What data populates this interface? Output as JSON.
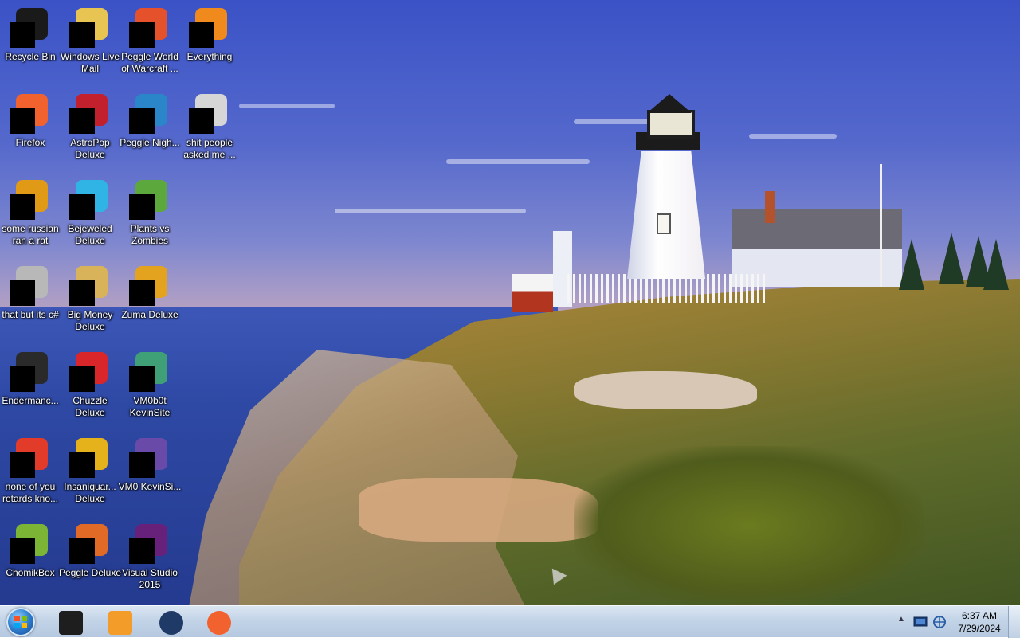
{
  "desktop": {
    "icons": [
      {
        "label": "Recycle Bin",
        "icon": "recycle-bin-icon",
        "color": "#1a1a1a"
      },
      {
        "label": "Windows Live Mail",
        "icon": "mail-icon",
        "color": "#e8c552"
      },
      {
        "label": "Peggle World of Warcraft ...",
        "icon": "peggle-icon",
        "color": "#e4512b"
      },
      {
        "label": "Everything",
        "icon": "everything-icon",
        "color": "#f08a1c"
      },
      {
        "label": "Firefox",
        "icon": "firefox-icon",
        "color": "#f2622e"
      },
      {
        "label": "AstroPop Deluxe",
        "icon": "astropop-icon",
        "color": "#c2202c"
      },
      {
        "label": "Peggle Nigh...",
        "icon": "peggle-nights-icon",
        "color": "#2a86c8"
      },
      {
        "label": "shit people asked me ...",
        "icon": "folder-icon",
        "color": "#d6d6d6"
      },
      {
        "label": "some russian ran a rat",
        "icon": "text-document-icon",
        "color": "#e09a16"
      },
      {
        "label": "Bejeweled Deluxe",
        "icon": "bejeweled-icon",
        "color": "#2fb4e5"
      },
      {
        "label": "Plants vs Zombies",
        "icon": "plants-vs-zombies-icon",
        "color": "#5ca83c"
      },
      {
        "label": "that but its c#",
        "icon": "shortcut-icon",
        "color": "#b8b8b8"
      },
      {
        "label": "Big Money Deluxe",
        "icon": "money-bag-icon",
        "color": "#d8b35a"
      },
      {
        "label": "Zuma Deluxe",
        "icon": "zuma-icon",
        "color": "#e3a31f"
      },
      {
        "label": "Endermanc...",
        "icon": "console-icon",
        "color": "#2a2a2a"
      },
      {
        "label": "Chuzzle Deluxe",
        "icon": "chuzzle-icon",
        "color": "#d9262a"
      },
      {
        "label": "VM0b0t KevinSite",
        "icon": "vm-icon",
        "color": "#3fa078"
      },
      {
        "label": "none of you retards kno...",
        "icon": "peggle-icon",
        "color": "#e23b2a"
      },
      {
        "label": "Insaniquar... Deluxe",
        "icon": "insaniquarium-icon",
        "color": "#e6b21c"
      },
      {
        "label": "VM0 KevinSi...",
        "icon": "vm-icon",
        "color": "#6a4aa8"
      },
      {
        "label": "ChomikBox",
        "icon": "chomikbox-icon",
        "color": "#7cb536"
      },
      {
        "label": "Peggle Deluxe",
        "icon": "peggle-icon",
        "color": "#e06a26"
      },
      {
        "label": "Visual Studio 2015",
        "icon": "visual-studio-icon",
        "color": "#68217a"
      }
    ]
  },
  "taskbar": {
    "start_icon": "windows-start-icon",
    "pinned": [
      {
        "name": "black-app-icon",
        "color": "#1e1e1e"
      },
      {
        "name": "media-player-icon",
        "color": "#f39c2a"
      },
      {
        "name": "globe-app-icon",
        "color": "#1f3a66"
      },
      {
        "name": "firefox-icon",
        "color": "#f2622e"
      }
    ],
    "tray": {
      "chevron": "▲",
      "icons": [
        "action-center-icon",
        "network-icon"
      ]
    },
    "clock": {
      "time": "6:37 AM",
      "date": "7/29/2024"
    }
  }
}
